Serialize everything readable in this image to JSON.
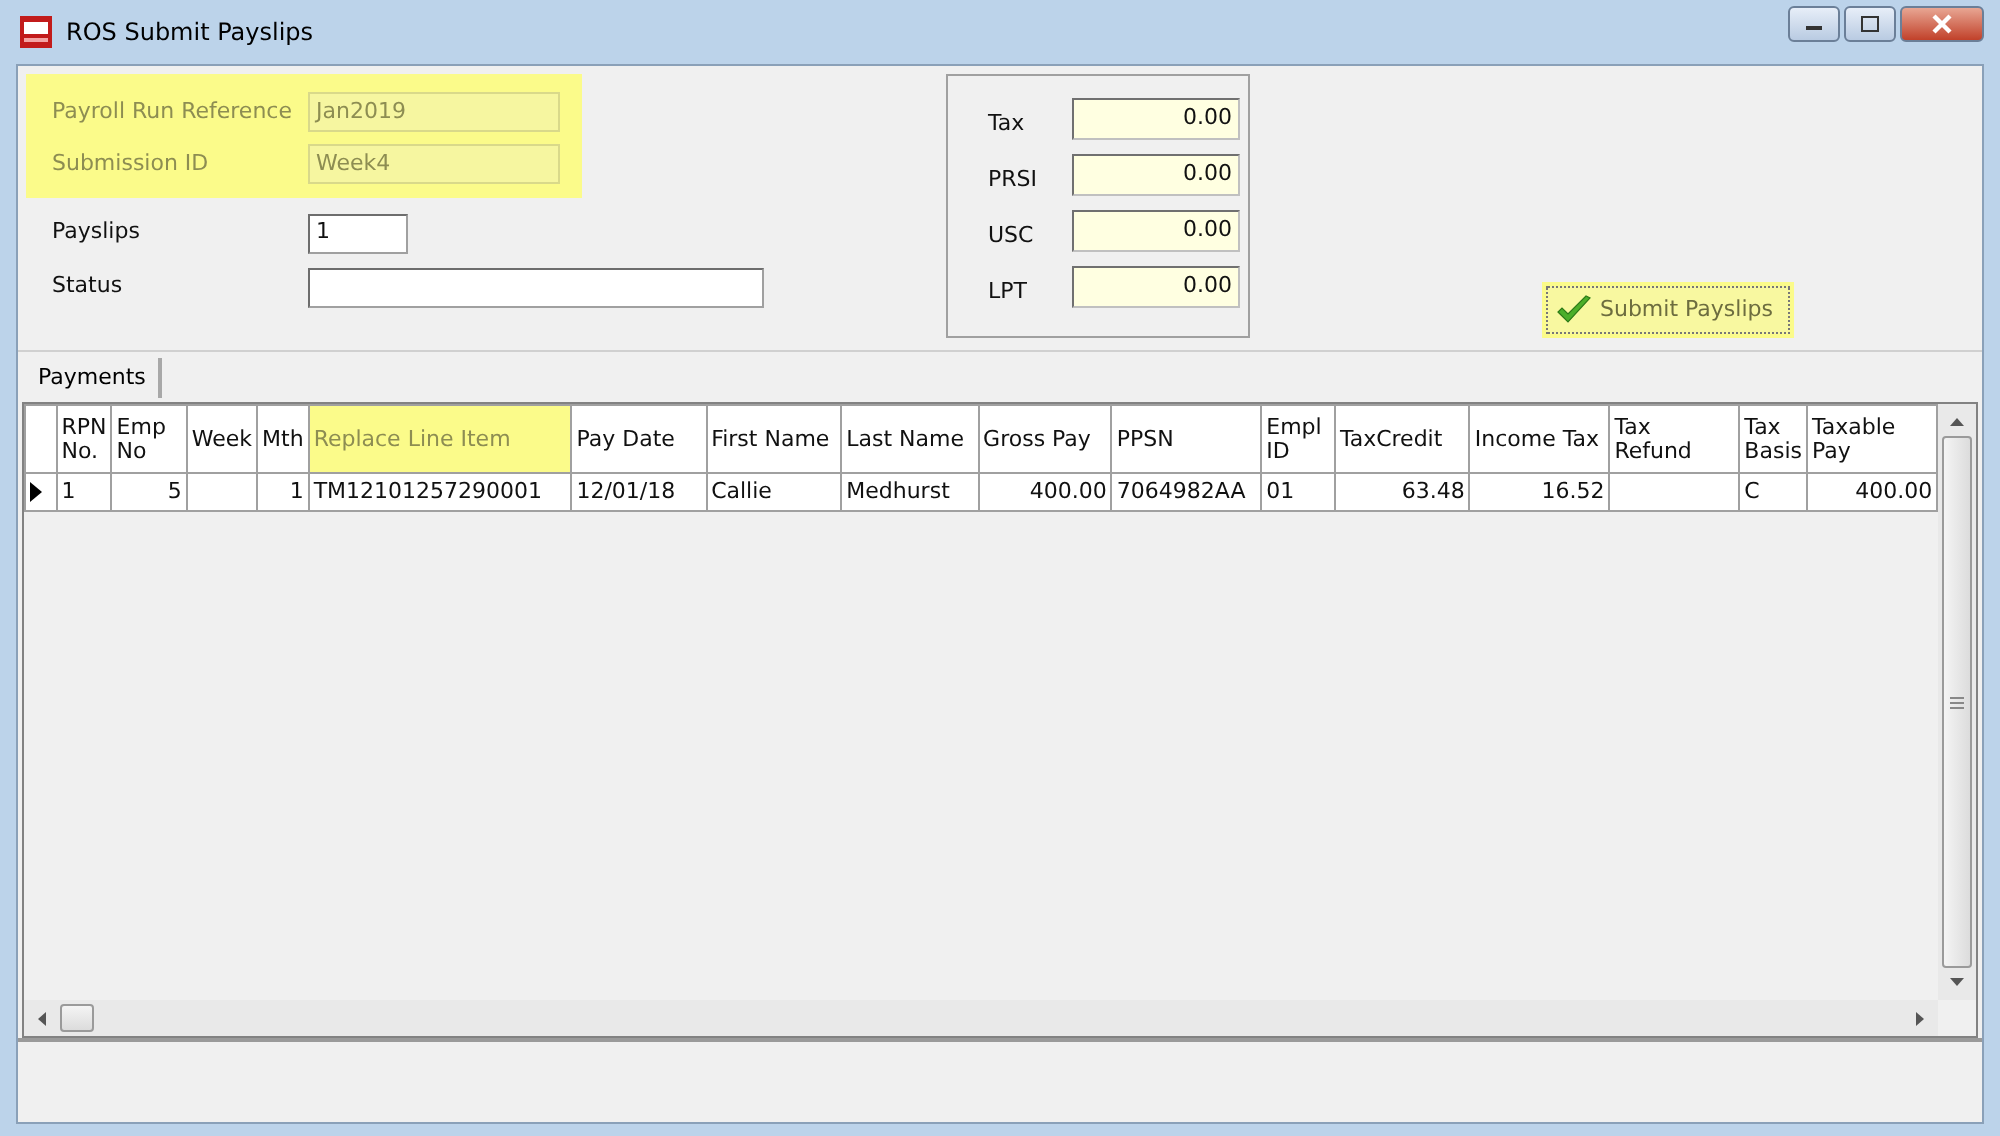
{
  "window": {
    "title": "ROS Submit Payslips"
  },
  "header_fields": [
    {
      "label": "Payroll Run Reference",
      "value": "Jan2019",
      "highlighted": true
    },
    {
      "label": "Submission ID",
      "value": "Week4",
      "highlighted": true
    },
    {
      "label": "Payslips",
      "value": "1",
      "highlighted": false
    },
    {
      "label": "Status",
      "highlighted": false
    }
  ],
  "totals": [
    {
      "label": "Tax",
      "value": "0.00"
    },
    {
      "label": "PRSI",
      "value": "0.00"
    },
    {
      "label": "USC",
      "value": "0.00"
    },
    {
      "label": "LPT",
      "value": "0.00"
    }
  ],
  "submit_button": {
    "label": "Submit Payslips",
    "highlighted": true
  },
  "tabs": [
    {
      "label": "Payments",
      "selected": true
    }
  ],
  "table": {
    "columns": [
      {
        "label": "RPN No.",
        "highlighted": false
      },
      {
        "label": "Emp No",
        "highlighted": false
      },
      {
        "label": "Week",
        "highlighted": false
      },
      {
        "label": "Mth",
        "highlighted": false
      },
      {
        "label": "Replace Line Item",
        "highlighted": true
      },
      {
        "label": "Pay Date",
        "highlighted": false
      },
      {
        "label": "First Name",
        "highlighted": false
      },
      {
        "label": "Last Name",
        "highlighted": false
      },
      {
        "label": "Gross Pay",
        "highlighted": false
      },
      {
        "label": "PPSN",
        "highlighted": false
      },
      {
        "label": "Empl ID",
        "highlighted": false
      },
      {
        "label": "TaxCredit",
        "highlighted": false
      },
      {
        "label": "Income Tax",
        "highlighted": false
      },
      {
        "label": "Tax Refund",
        "highlighted": false
      },
      {
        "label": "Tax Basis",
        "highlighted": false
      },
      {
        "label": "Taxable Pay",
        "highlighted": false
      }
    ],
    "rows": [
      {
        "selected": true,
        "cells": [
          "1",
          "5",
          "",
          "1",
          "TM12101257290001",
          "12/01/18",
          "Callie",
          "Medhurst",
          "400.00",
          "7064982AA",
          "01",
          "63.48",
          "16.52",
          "",
          "C",
          "400.00"
        ]
      }
    ]
  }
}
